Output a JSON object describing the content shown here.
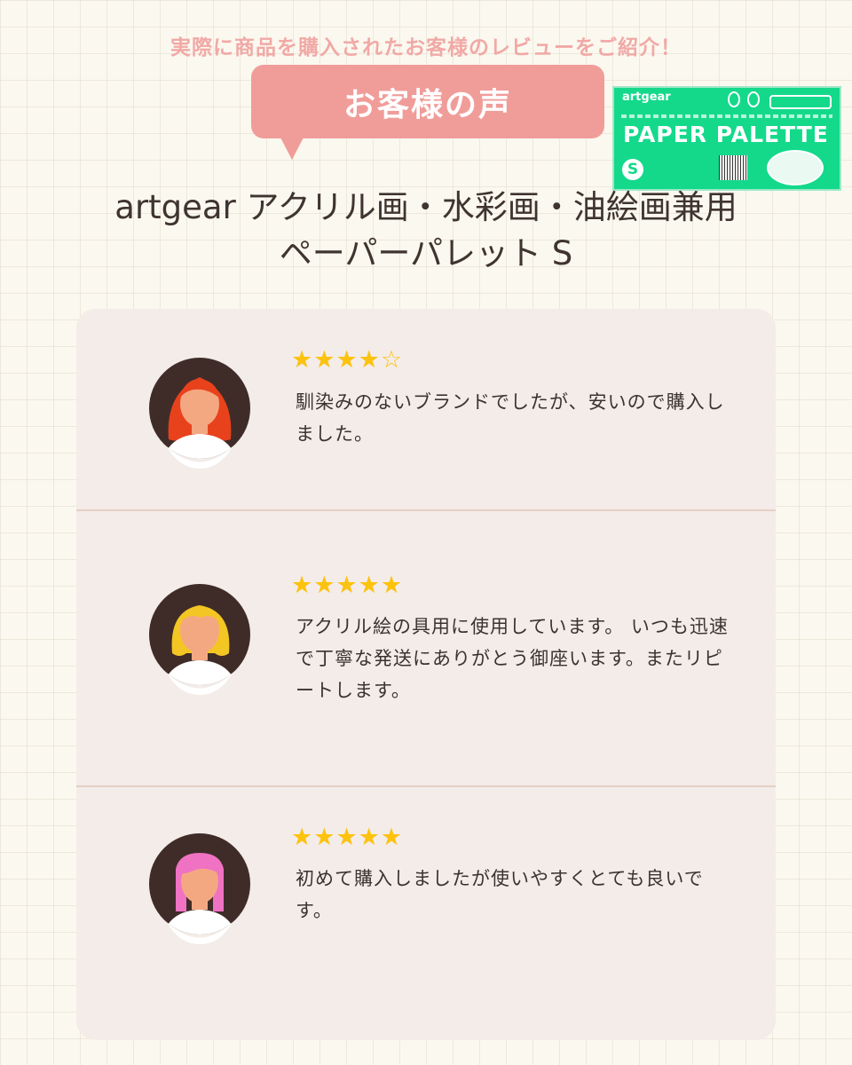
{
  "header": {
    "subtitle": "実際に商品を購入されたお客様のレビューをご紹介！",
    "badge": "お客様の声"
  },
  "product": {
    "title_line1": "artgear アクリル画・水彩画・油絵画兼用",
    "title_line2": "ペーパーパレット S",
    "package": {
      "brand": "artgear",
      "name": "PAPER PALETTE",
      "size": "S",
      "color": "#14d98b"
    }
  },
  "colors": {
    "accent": "#f09d9a",
    "subtitle": "#f1a9a6",
    "star": "#fcc20e",
    "card": "#f3ece8"
  },
  "reviews": [
    {
      "rating": 4,
      "max": 5,
      "text": "馴染みのないブランドでしたが、安いので購入しました。",
      "hair": "#e8421d",
      "avatar_icon": "woman-avatar-icon"
    },
    {
      "rating": 5,
      "max": 5,
      "text": "アクリル絵の具用に使用しています。 いつも迅速で丁寧な発送にありがとう御座います。またリピートします。",
      "hair": "#f3c624",
      "avatar_icon": "woman-avatar-icon"
    },
    {
      "rating": 5,
      "max": 5,
      "text": "初めて購入しましたが使いやすくとても良いです。",
      "hair": "#f072c3",
      "avatar_icon": "woman-avatar-icon"
    }
  ]
}
